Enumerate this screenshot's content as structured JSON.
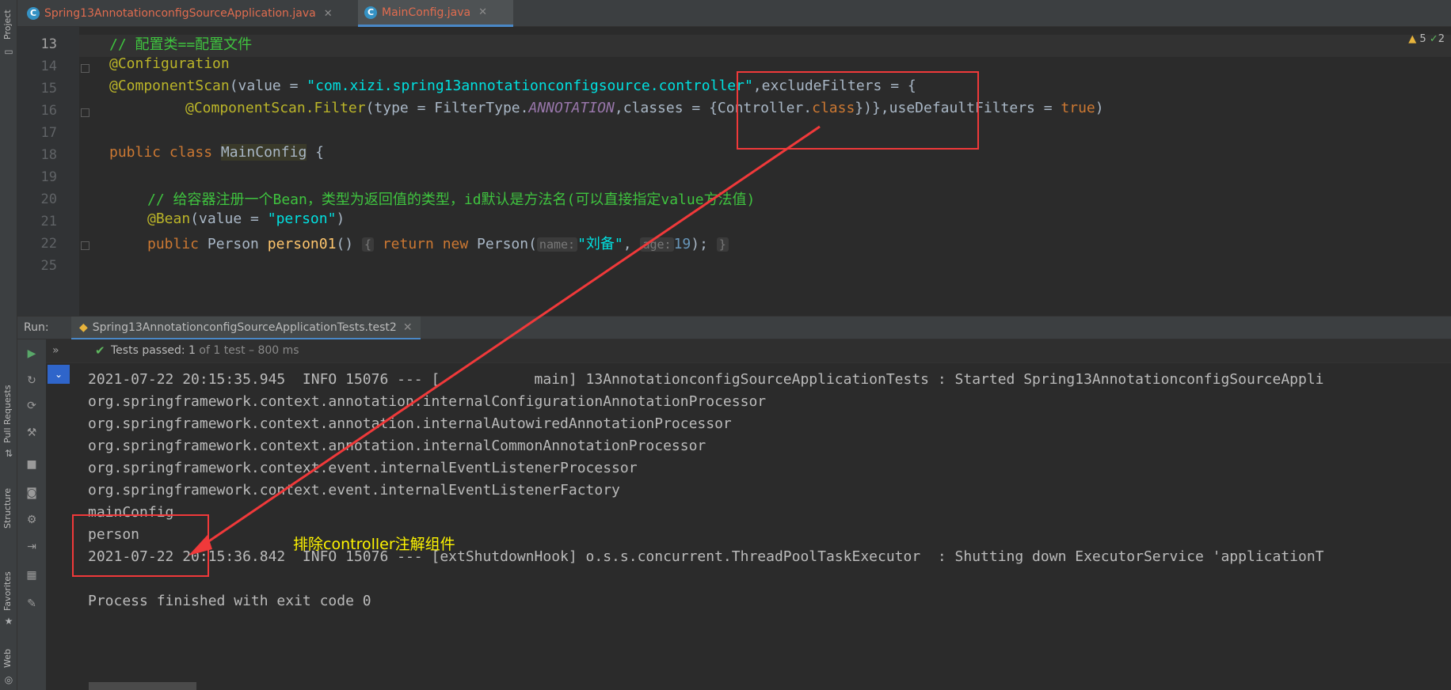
{
  "tabs": [
    {
      "label": "Spring13AnnotationconfigSourceApplication.java",
      "icon": "java-class-icon",
      "active": false
    },
    {
      "label": "MainConfig.java",
      "icon": "java-class-icon",
      "active": true
    }
  ],
  "left_strip": {
    "project": "Project",
    "pull_requests": "Pull Requests",
    "structure": "Structure",
    "favorites": "Favorites",
    "web": "Web"
  },
  "inspections": {
    "warnings": "5",
    "ok": "2"
  },
  "editor": {
    "line_numbers": [
      "13",
      "14",
      "15",
      "16",
      "17",
      "18",
      "19",
      "20",
      "21",
      "22",
      "25"
    ],
    "l13_comment": "// 配置类==配置文件",
    "l14_annotation": "@Configuration",
    "l15_annotation": "@ComponentScan",
    "l15_value_key": "(value = ",
    "l15_value_str": "\"com.xizi.spring13annotationconfigsource.controller\"",
    "l15_rest": ",excludeFilters = {",
    "l16_annotation": "@ComponentScan.Filter",
    "l16_type": "(type = FilterType.",
    "l16_enum": "ANNOTATION",
    "l16_classes": ",classes = {Controller.",
    "l16_class_kw": "class",
    "l16_close": "})},useDefaultFilters = ",
    "l16_true": "true",
    "l16_end": ")",
    "l18_public": "public",
    "l18_class": "class",
    "l18_name": "MainConfig",
    "l18_brace": " {",
    "l20_comment": "// 给容器注册一个Bean，类型为返回值的类型，id默认是方法名(可以直接指定value方法值)",
    "l21_annotation": "@Bean",
    "l21_value_key": "(value = ",
    "l21_value_str": "\"person\"",
    "l21_end": ")",
    "l22_public": "public",
    "l22_type": " Person ",
    "l22_method": "person01",
    "l22_parens": "() ",
    "l22_brace_open": "{",
    "l22_return": "return",
    "l22_new": "new",
    "l22_ctor": " Person(",
    "l22_hint_name": "name:",
    "l22_name_val": "\"刘备\"",
    "l22_comma": ", ",
    "l22_hint_age": "age:",
    "l22_age_val": "19",
    "l22_close": "); ",
    "l22_brace_close": "}"
  },
  "run": {
    "label": "Run:",
    "tab": "Spring13AnnotationconfigSourceApplicationTests.test2",
    "status_passed": "Tests passed: 1",
    "status_detail": "of 1 test – 800 ms",
    "output": [
      "2021-07-22 20:15:35.945  INFO 15076 --- [           main] 13AnnotationconfigSourceApplicationTests : Started Spring13AnnotationconfigSourceAppli",
      "org.springframework.context.annotation.internalConfigurationAnnotationProcessor",
      "org.springframework.context.annotation.internalAutowiredAnnotationProcessor",
      "org.springframework.context.annotation.internalCommonAnnotationProcessor",
      "org.springframework.context.event.internalEventListenerProcessor",
      "org.springframework.context.event.internalEventListenerFactory",
      "mainConfig",
      "person",
      "2021-07-22 20:15:36.842  INFO 15076 --- [extShutdownHook] o.s.s.concurrent.ThreadPoolTaskExecutor  : Shutting down ExecutorService 'applicationT",
      "",
      "Process finished with exit code 0"
    ]
  },
  "annotation_note": "排除controller注解组件",
  "colors": {
    "accent": "#4a88c7",
    "annotation_red": "#f0393a",
    "note_yellow": "#fff500",
    "pass_green": "#5fb85f"
  }
}
